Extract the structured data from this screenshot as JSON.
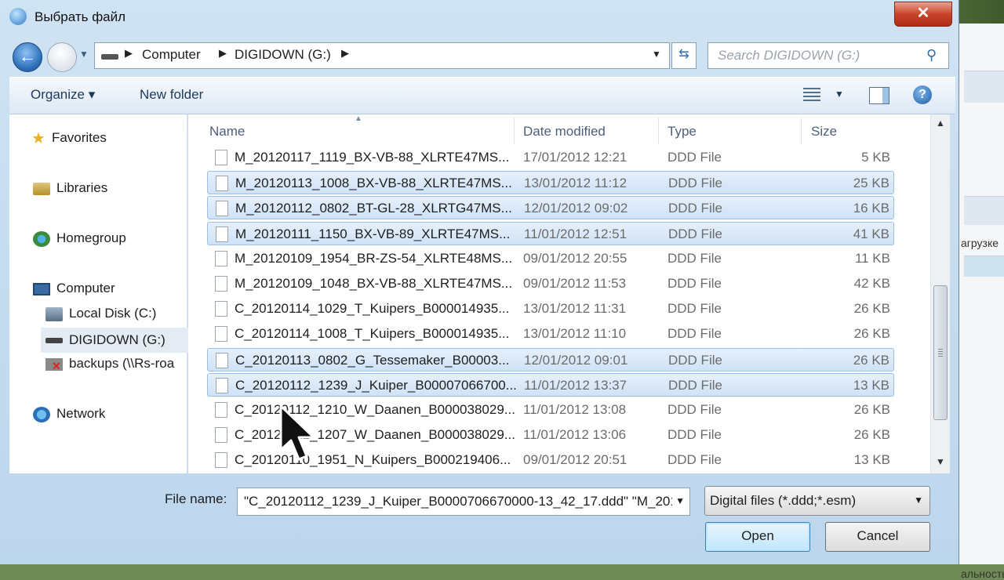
{
  "window": {
    "title": "Выбрать файл",
    "close_label": "✕"
  },
  "address": {
    "crumbs": [
      "Computer",
      "DIGIDOWN (G:)"
    ],
    "search_placeholder": "Search DIGIDOWN (G:)"
  },
  "toolbar": {
    "organize_label": "Organize ▾",
    "new_folder_label": "New folder",
    "help_label": "?"
  },
  "nav": {
    "favorites": "Favorites",
    "libraries": "Libraries",
    "homegroup": "Homegroup",
    "computer": "Computer",
    "local_disk": "Local Disk (C:)",
    "digidown": "DIGIDOWN (G:)",
    "backups": "backups (\\\\Rs-roa",
    "network": "Network"
  },
  "columns": {
    "name": "Name",
    "date": "Date modified",
    "type": "Type",
    "size": "Size"
  },
  "files": [
    {
      "name": "M_20120117_1119_BX-VB-88_XLRTE47MS...",
      "date": "17/01/2012 12:21",
      "type": "DDD File",
      "size": "5 KB",
      "selected": false
    },
    {
      "name": "M_20120113_1008_BX-VB-88_XLRTE47MS...",
      "date": "13/01/2012 11:12",
      "type": "DDD File",
      "size": "25 KB",
      "selected": true
    },
    {
      "name": "M_20120112_0802_BT-GL-28_XLRTG47MS...",
      "date": "12/01/2012 09:02",
      "type": "DDD File",
      "size": "16 KB",
      "selected": true
    },
    {
      "name": "M_20120111_1150_BX-VB-89_XLRTE47MS...",
      "date": "11/01/2012 12:51",
      "type": "DDD File",
      "size": "41 KB",
      "selected": true
    },
    {
      "name": "M_20120109_1954_BR-ZS-54_XLRTE48MS...",
      "date": "09/01/2012 20:55",
      "type": "DDD File",
      "size": "11 KB",
      "selected": false
    },
    {
      "name": "M_20120109_1048_BX-VB-88_XLRTE47MS...",
      "date": "09/01/2012 11:53",
      "type": "DDD File",
      "size": "42 KB",
      "selected": false
    },
    {
      "name": "C_20120114_1029_T_Kuipers_B000014935...",
      "date": "13/01/2012 11:31",
      "type": "DDD File",
      "size": "26 KB",
      "selected": false
    },
    {
      "name": "C_20120114_1008_T_Kuipers_B000014935...",
      "date": "13/01/2012 11:10",
      "type": "DDD File",
      "size": "26 KB",
      "selected": false
    },
    {
      "name": "C_20120113_0802_G_Tessemaker_B00003...",
      "date": "12/01/2012 09:01",
      "type": "DDD File",
      "size": "26 KB",
      "selected": true
    },
    {
      "name": "C_20120112_1239_J_Kuiper_B00007066700...",
      "date": "11/01/2012 13:37",
      "type": "DDD File",
      "size": "13 KB",
      "selected": true
    },
    {
      "name": "C_20120112_1210_W_Daanen_B000038029...",
      "date": "11/01/2012 13:08",
      "type": "DDD File",
      "size": "26 KB",
      "selected": false
    },
    {
      "name": "C_20120112_1207_W_Daanen_B000038029...",
      "date": "11/01/2012 13:06",
      "type": "DDD File",
      "size": "26 KB",
      "selected": false
    },
    {
      "name": "C_20120110_1951_N_Kuipers_B000219406...",
      "date": "09/01/2012 20:51",
      "type": "DDD File",
      "size": "13 KB",
      "selected": false
    }
  ],
  "bottom": {
    "file_name_label": "File name:",
    "file_name_value": "\"C_20120112_1239_J_Kuiper_B0000706670000-13_42_17.ddd\" \"M_201",
    "filter_value": "Digital files (*.ddd;*.esm)",
    "open_label": "Open",
    "cancel_label": "Cancel"
  },
  "background_app": {
    "text1": "агрузке",
    "text2": "альность"
  },
  "colors": {
    "accent": "#2b6fb8",
    "selection": "#cfe2f7",
    "close": "#c7442a"
  }
}
